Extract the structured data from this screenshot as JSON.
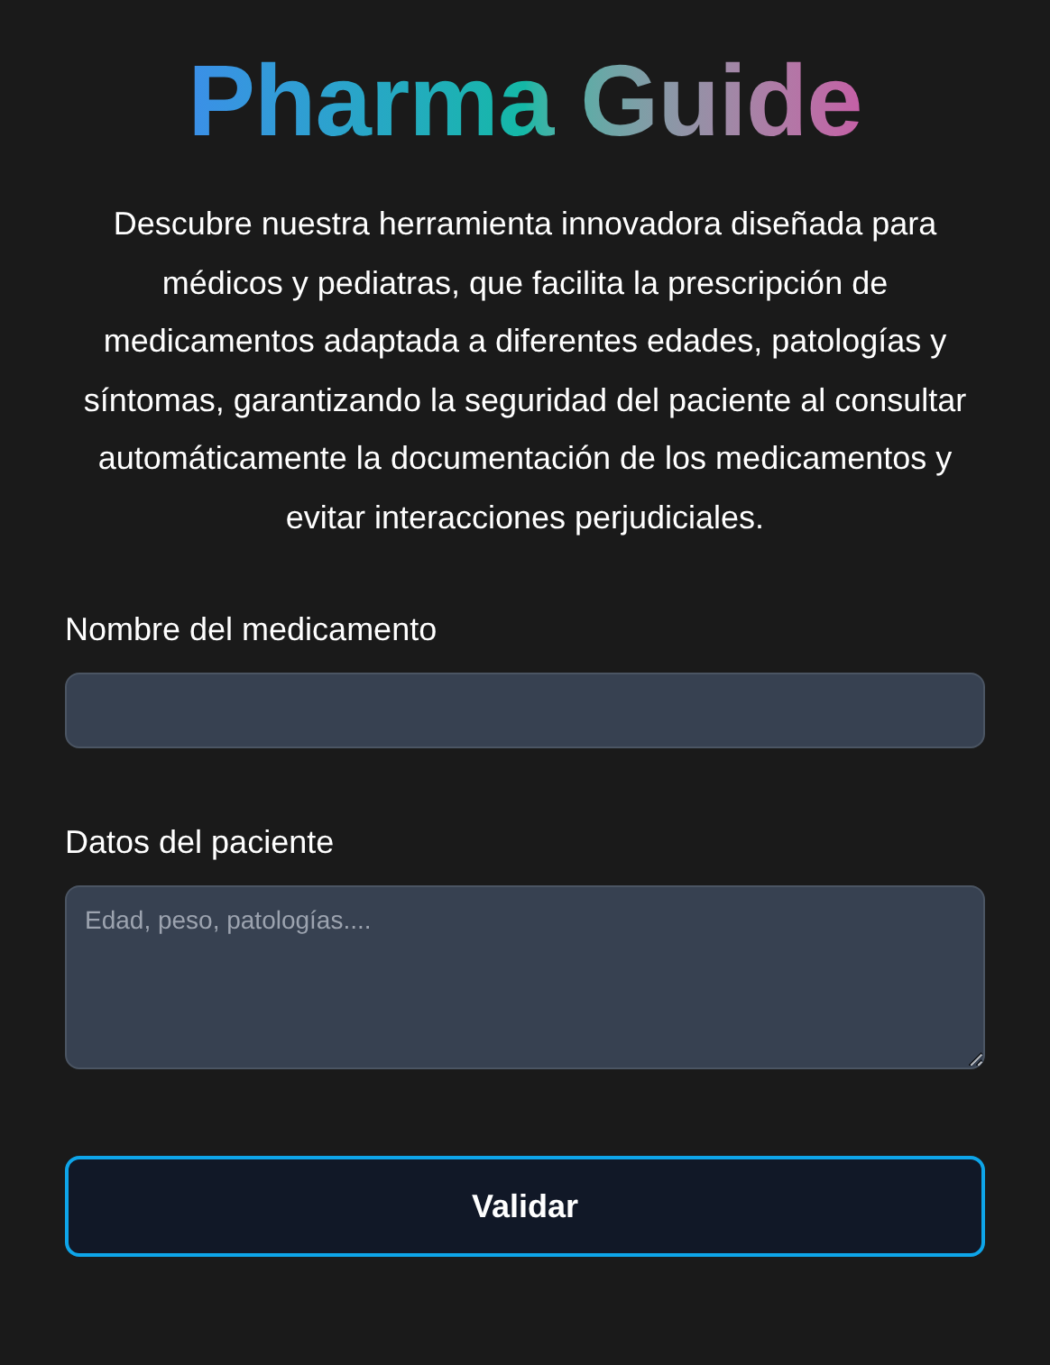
{
  "title": "Pharma Guide",
  "description": "Descubre nuestra herramienta innovadora diseñada para médicos y pediatras, que facilita la prescripción de medicamentos adaptada a diferentes edades, patologías y síntomas, garantizando la seguridad del paciente al consultar automáticamente la documentación de los medicamentos y evitar interacciones perjudiciales.",
  "fields": [
    {
      "kind": "input",
      "label": "Nombre del medicamento"
    },
    {
      "kind": "textarea",
      "label": "Datos del paciente",
      "placeholder": "Edad, peso, patologías...."
    }
  ],
  "button": "Validar"
}
